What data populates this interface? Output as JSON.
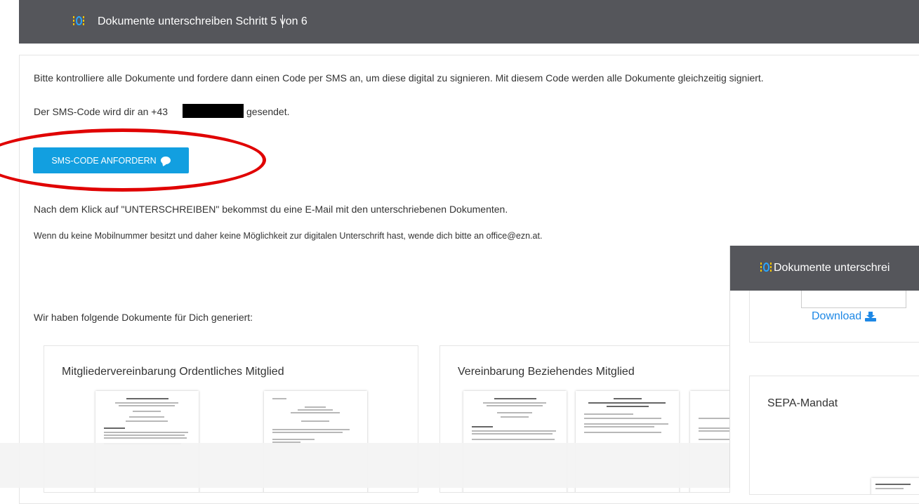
{
  "header": {
    "title": "Dokumente unterschreiben Schritt 5 von 6",
    "logo_icon": "lightbulb-icon"
  },
  "content": {
    "intro": "Bitte kontrolliere alle Dokumente und fordere dann einen Code per SMS an, um diese digital zu signieren. Mit diesem Code werden alle Dokumente gleichzeitig signiert.",
    "sms_prefix": "Der SMS-Code wird dir an +43",
    "sms_suffix": "gesendet.",
    "sms_button": "SMS-CODE ANFORDERN",
    "sms_button_icon": "chat-icon",
    "after_click": "Nach dem Klick auf \"UNTERSCHREIBEN\" bekommst du eine E-Mail mit den unterschriebenen Dokumenten.",
    "no_mobile": "Wenn du keine Mobilnummer besitzt und daher keine Möglichkeit zur digitalen Unterschrift hast, wende dich bitte an office@ezn.at.",
    "generated_heading": "Wir haben folgende Dokumente für Dich generiert:"
  },
  "documents": [
    {
      "title": "Mitgliedervereinbarung Ordentliches Mitglied"
    },
    {
      "title": "Vereinbarung Beziehendes Mitglied"
    }
  ],
  "overlay": {
    "title": "Dokumente unterschrei",
    "download": "Download",
    "download_icon": "download-icon",
    "sepa_title": "SEPA-Mandat"
  },
  "colors": {
    "header_bg": "#55565b",
    "button_bg": "#129fe0",
    "highlight_ring": "#e00000",
    "link": "#1e88e5"
  }
}
